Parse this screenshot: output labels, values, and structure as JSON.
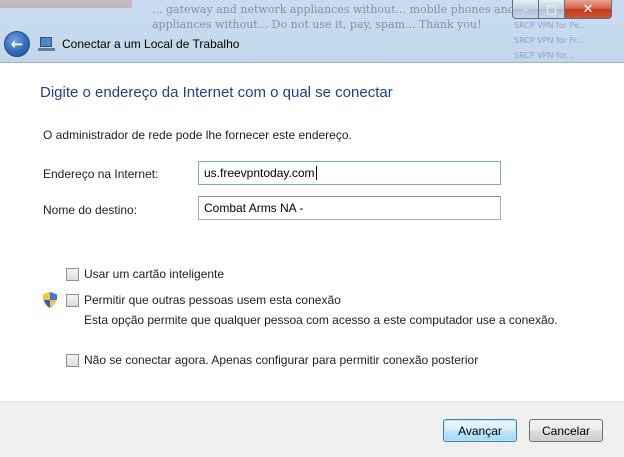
{
  "window": {
    "background_text": "... gateway and network appliances without... mobile phones and network appliances without... Do not use it, pay, spam... Thank you!",
    "background_links": [
      "SRCP VPN for Pe...",
      "SRCP VPN for Fr...",
      "SRCP VPN for..."
    ]
  },
  "caption": {
    "minimize": "–",
    "maximize": "□",
    "close": "✕"
  },
  "nav": {
    "back_icon": "back-arrow-icon",
    "app_icon": "network-workplace-icon",
    "title": "Conectar a um Local de Trabalho"
  },
  "main": {
    "heading": "Digite o endereço da Internet com o qual se conectar",
    "description": "O administrador de rede pode lhe fornecer este endereço.",
    "address_label": "Endereço na Internet:",
    "address_value": "us.freevpntoday.com",
    "destination_label": "Nome do destino:",
    "destination_value": "Combat Arms NA -",
    "options": {
      "smart_card": "Usar um cartão inteligente",
      "allow_others": "Permitir que outras pessoas usem esta conexão",
      "allow_others_desc": "Esta opção permite que qualquer pessoa com acesso a este computador use a conexão.",
      "dont_connect": "Não se conectar agora. Apenas configurar para permitir conexão posterior"
    },
    "shield_icon": "uac-shield-icon"
  },
  "footer": {
    "next_label": "Avançar",
    "cancel_label": "Cancelar"
  },
  "colors": {
    "heading": "#1e3f8a",
    "frame": "#b8cfe6",
    "content_bg": "#ffffff",
    "footer_bg": "#f0f0f0"
  }
}
